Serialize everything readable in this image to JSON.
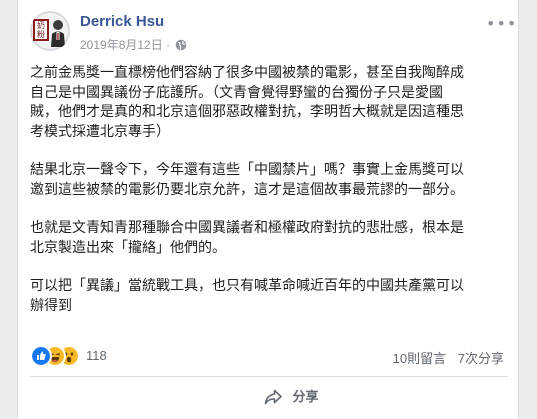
{
  "post": {
    "author": "Derrick Hsu",
    "date": "2019年8月12日",
    "avatar_stamp": "奶粉",
    "paragraphs": [
      "之前金馬獎一直標榜他們容納了很多中國被禁的電影，甚至自我陶醉成\n自己是中國異議份子庇護所。（文青會覺得野蠻的台獨份子只是愛國\n賊，他們才是真的和北京這個邪惡政權對抗，李明哲大概就是因這種思\n考模式採遭北京專手）",
      "結果北京一聲令下，今年還有這些「中國禁片」嗎？事實上金馬獎可以\n邀到這些被禁的電影仍要北京允許，這才是這個故事最荒謬的一部分。",
      "也就是文青知青那種聯合中國異議者和極權政府對抗的悲壯感，根本是\n北京製造出來「攏絡」他們的。",
      "可以把「異議」當統戰工具，也只有喊革命喊近百年的中國共產黨可以\n辦得到"
    ]
  },
  "stats": {
    "reaction_count": "118",
    "comments": "10則留言",
    "shares": "7次分享"
  },
  "actions": {
    "share_label": "分享"
  },
  "icons": {
    "privacy": "globe-icon",
    "more": "more-options-icon",
    "share": "share-arrow-icon",
    "reactions": [
      "like-icon",
      "haha-icon",
      "wow-icon"
    ]
  },
  "colors": {
    "author": "#385898",
    "like": "#1877f2",
    "haha": "#f7b928"
  }
}
